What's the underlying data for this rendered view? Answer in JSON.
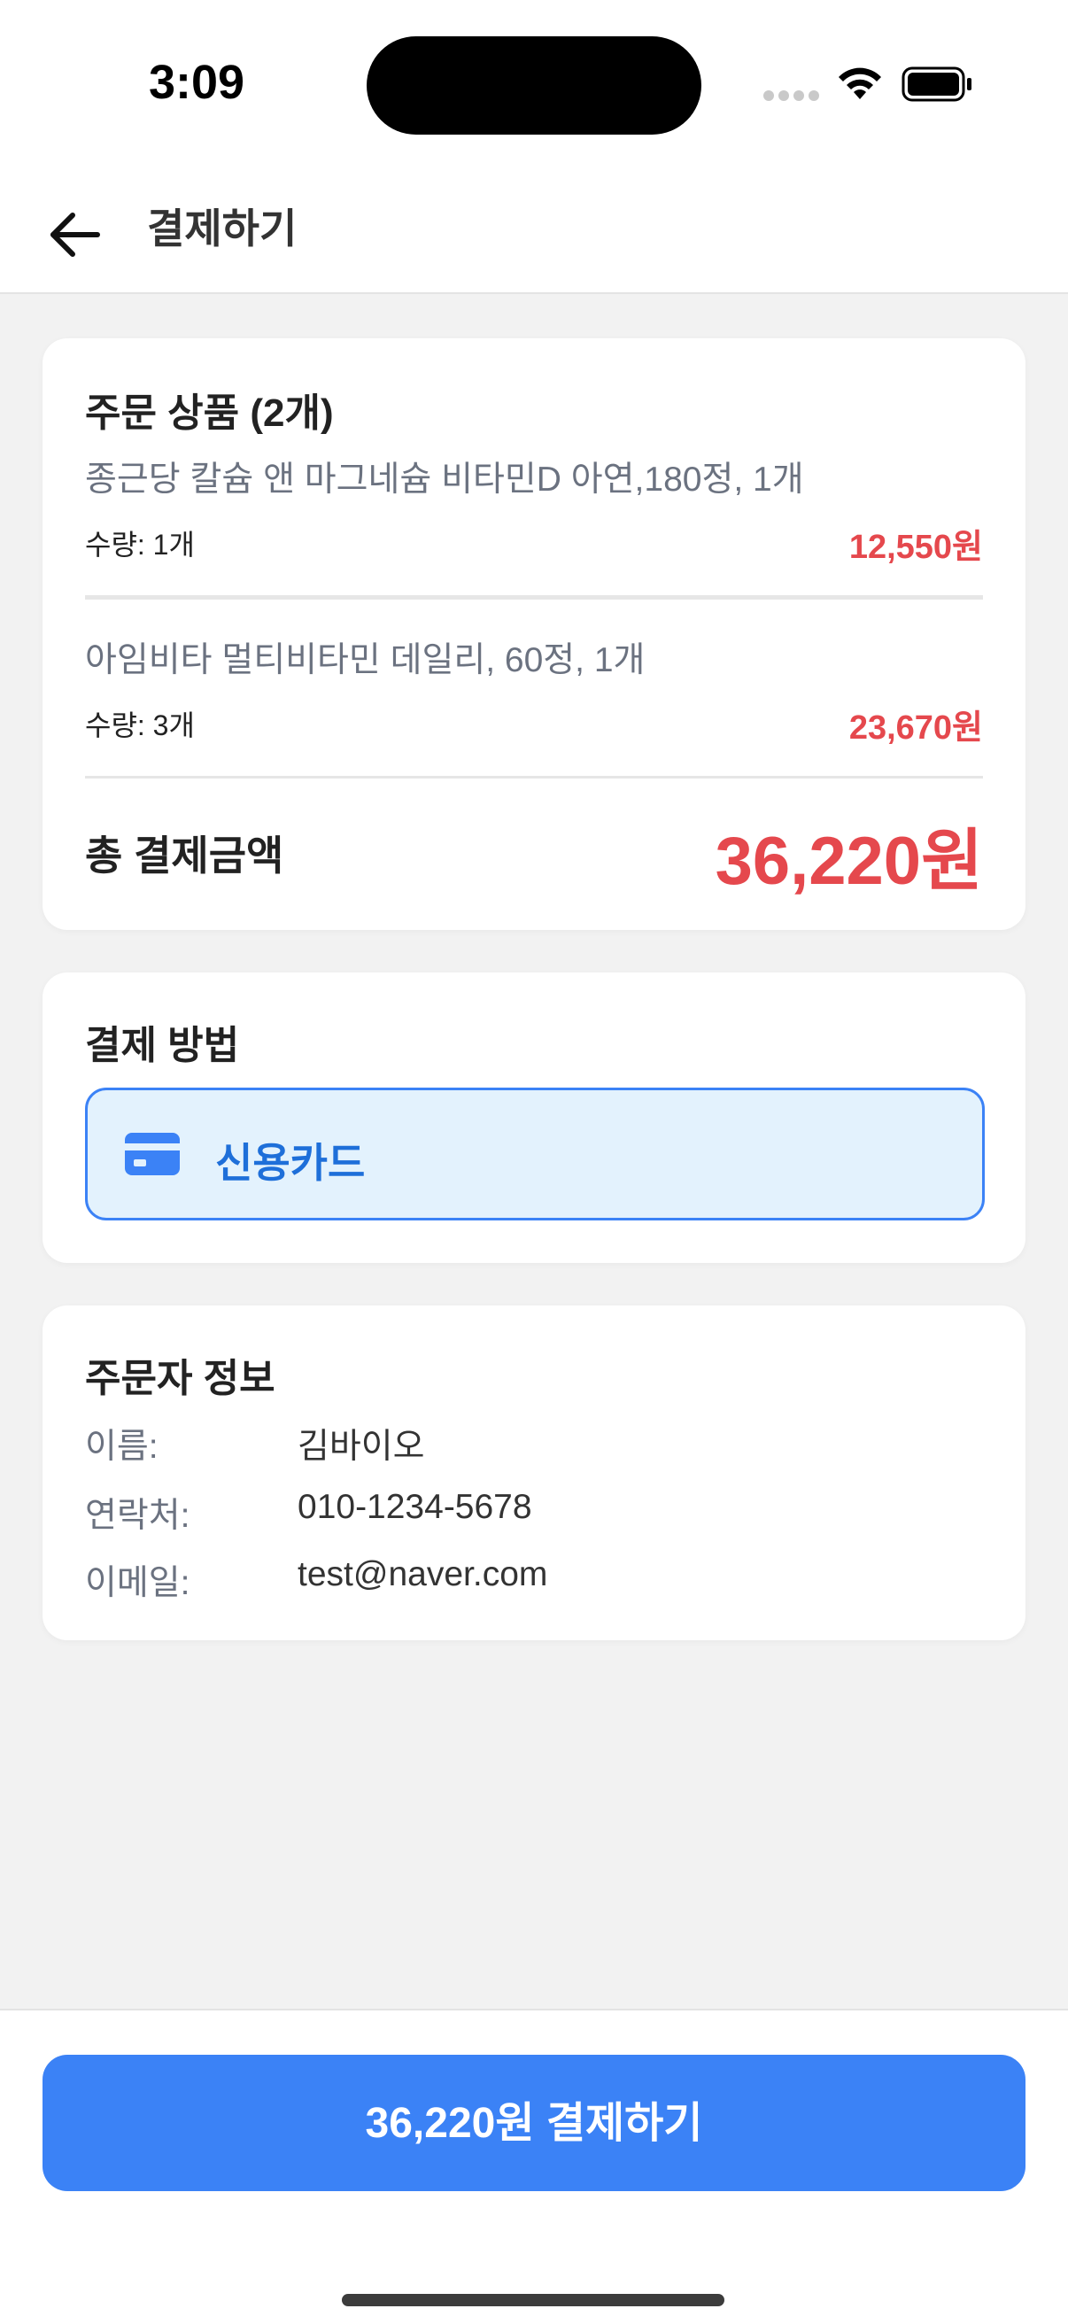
{
  "status_bar": {
    "time": "3:09"
  },
  "header": {
    "title": "결제하기"
  },
  "order": {
    "title": "주문 상품 (2개)",
    "items": [
      {
        "name": "종근당 칼슘 앤 마그네슘 비타민D 아연,180정, 1개",
        "quantity": "수량: 1개",
        "price": "12,550원"
      },
      {
        "name": "아임비타 멀티비타민 데일리, 60정, 1개",
        "quantity": "수량: 3개",
        "price": "23,670원"
      }
    ],
    "total_label": "총 결제금액",
    "total_value": "36,220원"
  },
  "payment": {
    "title": "결제 방법",
    "selected_method": "신용카드"
  },
  "orderer": {
    "title": "주문자 정보",
    "rows": [
      {
        "label": "이름:",
        "value": "김바이오"
      },
      {
        "label": "연락처:",
        "value": "010-1234-5678"
      },
      {
        "label": "이메일:",
        "value": "test@naver.com"
      }
    ]
  },
  "pay_button": {
    "label": "36,220원 결제하기"
  },
  "colors": {
    "accent": "#3b82f6",
    "price_red": "#e5484d",
    "method_bg": "#e3f2fd"
  }
}
